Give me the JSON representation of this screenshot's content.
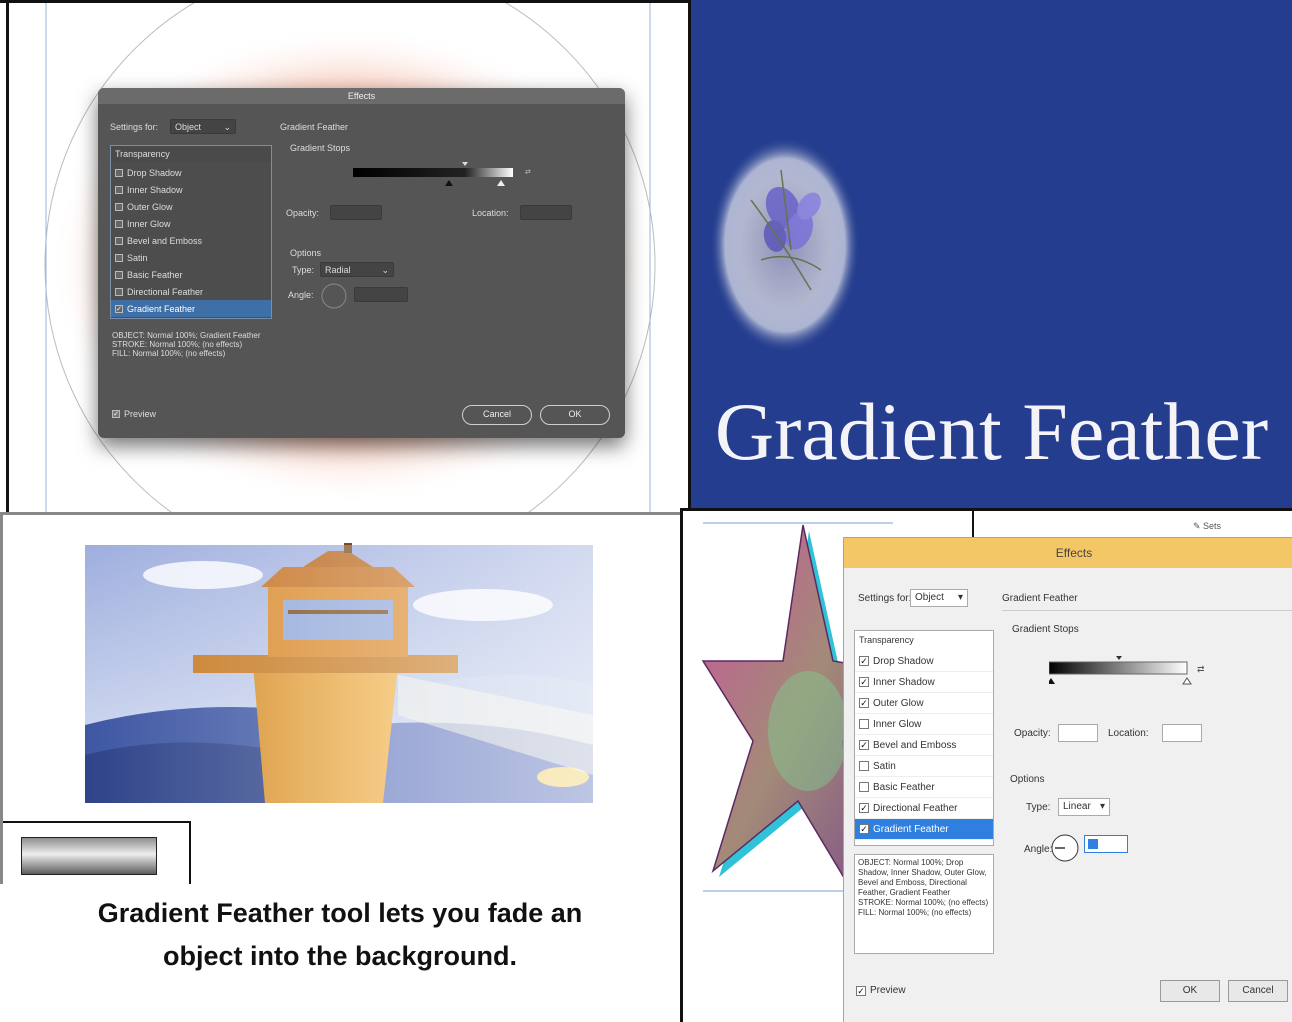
{
  "caption": {
    "line1": "Gradient Feather tool lets you fade an",
    "line2": "object into the background."
  },
  "banner": {
    "title": "Gradient Feather",
    "background_color": "#243d8e"
  },
  "dark_dialog": {
    "title": "Effects",
    "settings_for_label": "Settings for:",
    "settings_for_value": "Object",
    "section_title": "Gradient Feather",
    "gradient_stops_label": "Gradient Stops",
    "opacity_label": "Opacity:",
    "location_label": "Location:",
    "options_label": "Options",
    "type_label": "Type:",
    "type_value": "Radial",
    "angle_label": "Angle:",
    "list_header": "Transparency",
    "effects": [
      {
        "label": "Drop Shadow",
        "checked": false
      },
      {
        "label": "Inner Shadow",
        "checked": false
      },
      {
        "label": "Outer Glow",
        "checked": false
      },
      {
        "label": "Inner Glow",
        "checked": false
      },
      {
        "label": "Bevel and Emboss",
        "checked": false
      },
      {
        "label": "Satin",
        "checked": false
      },
      {
        "label": "Basic Feather",
        "checked": false
      },
      {
        "label": "Directional Feather",
        "checked": false
      },
      {
        "label": "Gradient Feather",
        "checked": true,
        "selected": true
      }
    ],
    "summary": "OBJECT: Normal 100%; Gradient Feather\nSTROKE: Normal 100%; (no effects)\nFILL: Normal 100%; (no effects)",
    "preview_label": "Preview",
    "preview_checked": true,
    "cancel_label": "Cancel",
    "ok_label": "OK"
  },
  "light_dialog": {
    "title": "Effects",
    "settings_for_label": "Settings for:",
    "settings_for_value": "Object",
    "section_title": "Gradient Feather",
    "gradient_stops_label": "Gradient Stops",
    "opacity_label": "Opacity:",
    "location_label": "Location:",
    "options_label": "Options",
    "type_label": "Type:",
    "type_value": "Linear",
    "angle_label": "Angle:",
    "list_header": "Transparency",
    "effects": [
      {
        "label": "Drop Shadow",
        "checked": true
      },
      {
        "label": "Inner Shadow",
        "checked": true
      },
      {
        "label": "Outer Glow",
        "checked": true
      },
      {
        "label": "Inner Glow",
        "checked": false
      },
      {
        "label": "Bevel and Emboss",
        "checked": true
      },
      {
        "label": "Satin",
        "checked": false
      },
      {
        "label": "Basic Feather",
        "checked": false
      },
      {
        "label": "Directional Feather",
        "checked": true
      },
      {
        "label": "Gradient Feather",
        "checked": true,
        "selected": true
      }
    ],
    "summary": "OBJECT: Normal 100%; Drop Shadow, Inner Shadow, Outer Glow, Bevel and Emboss, Directional Feather, Gradient Feather\nSTROKE: Normal 100%; (no effects)\nFILL: Normal 100%; (no effects)",
    "preview_label": "Preview",
    "preview_checked": true,
    "ok_label": "OK",
    "cancel_label": "Cancel"
  },
  "colors": {
    "dialog_dark": "#555555",
    "dialog_light_title": "#f3c766",
    "selection_blue": "#2f7fe0",
    "feather_orange": "#e8502a"
  }
}
